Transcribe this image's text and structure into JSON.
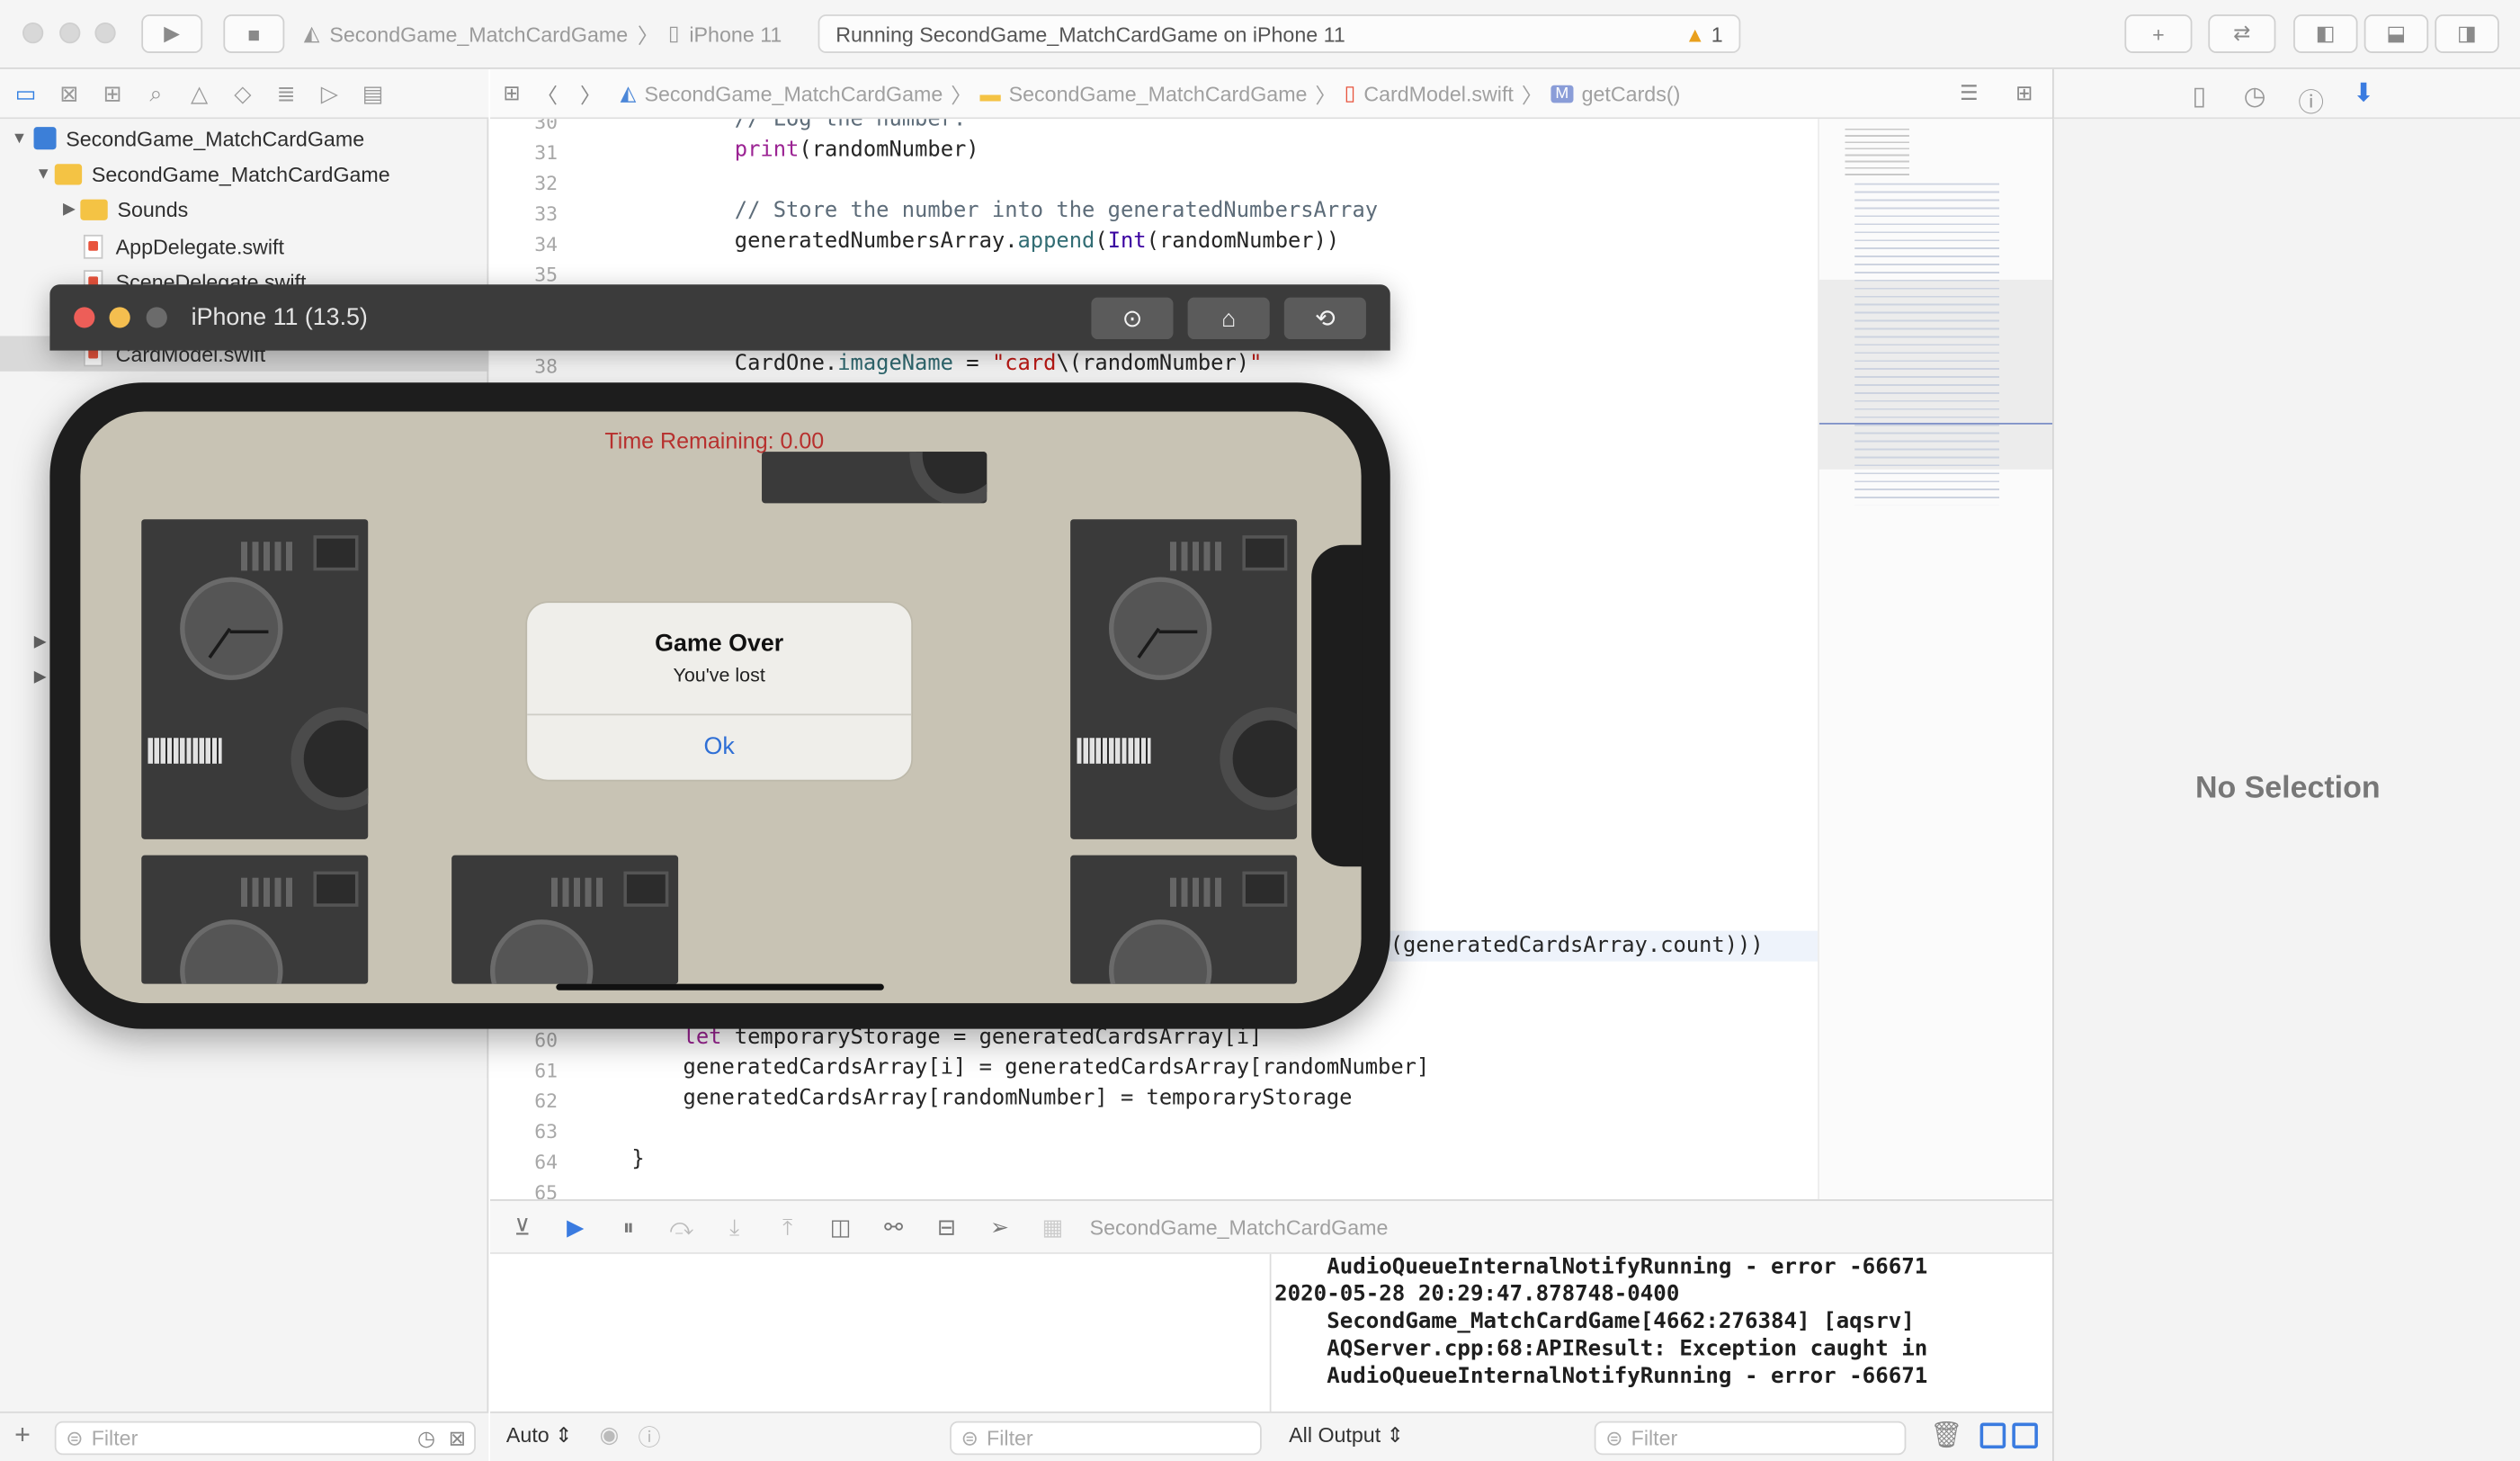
{
  "toolbar": {
    "scheme": "SecondGame_MatchCardGame",
    "device": "iPhone 11",
    "status": "Running SecondGame_MatchCardGame on iPhone 11",
    "warning_count": "1"
  },
  "navigator": {
    "items": [
      {
        "label": "SecondGame_MatchCardGame"
      },
      {
        "label": "SecondGame_MatchCardGame"
      },
      {
        "label": "Sounds"
      },
      {
        "label": "AppDelegate.swift"
      },
      {
        "label": "SceneDelegate.swift"
      },
      {
        "label": "CardModel.swift"
      }
    ],
    "filter_placeholder": "Filter"
  },
  "jumpbar": {
    "crumbs": [
      "SecondGame_MatchCardGame",
      "SecondGame_MatchCardGame",
      "CardModel.swift",
      "getCards()"
    ]
  },
  "editor": {
    "lines": [
      {
        "num": "30",
        "text": "            // Log the number."
      },
      {
        "num": "31",
        "text": "            print(randomNumber)"
      },
      {
        "num": "32",
        "text": ""
      },
      {
        "num": "33",
        "text": "            // Store the number into the generatedNumbersArray"
      },
      {
        "num": "34",
        "text": "            generatedNumbersArray.append(Int(randomNumber))"
      },
      {
        "num": "35",
        "text": ""
      },
      {
        "num": "38",
        "text": "            CardOne.imageName = \"card\\(randomNumber)\""
      },
      {
        "num": "60",
        "text": "        let temporaryStorage = generatedCardsArray[i]"
      },
      {
        "num": "61",
        "text": "        generatedCardsArray[i] = generatedCardsArray[randomNumber]"
      },
      {
        "num": "62",
        "text": "        generatedCardsArray[randomNumber] = temporaryStorage"
      },
      {
        "num": "63",
        "text": ""
      },
      {
        "num": "64",
        "text": "    }"
      },
      {
        "num": "65",
        "text": ""
      }
    ],
    "fragment_57": "(generatedCardsArray.count)))"
  },
  "debug": {
    "target": "SecondGame_MatchCardGame",
    "console_lines": [
      "    AudioQueueInternalNotifyRunning - error -66671",
      "2020-05-28 20:29:47.878748-0400",
      "    SecondGame_MatchCardGame[4662:276384] [aqsrv]",
      "    AQServer.cpp:68:APIResult: Exception caught in",
      "    AudioQueueInternalNotifyRunning - error -66671"
    ],
    "auto_label": "Auto",
    "var_filter_placeholder": "Filter",
    "output_label": "All Output",
    "console_filter_placeholder": "Filter"
  },
  "inspector": {
    "empty_label": "No Selection"
  },
  "simulator": {
    "title": "iPhone 11 (13.5)",
    "timer": "Time Remaining: 0.00",
    "alert_title": "Game Over",
    "alert_message": "You've lost",
    "alert_button": "Ok"
  },
  "colors": {
    "timer_red": "#b7302e",
    "alert_blue": "#2f6fd5"
  }
}
